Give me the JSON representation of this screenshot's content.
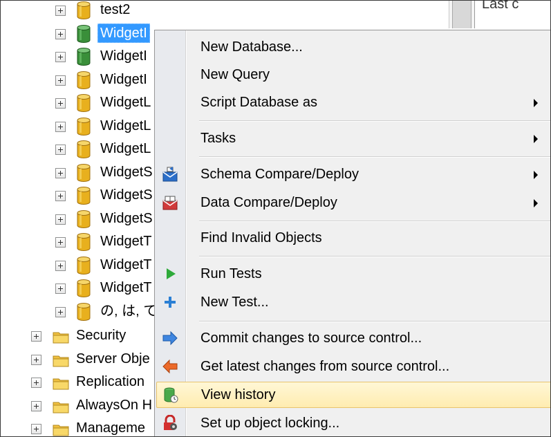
{
  "background": {
    "partial_text": "Last c"
  },
  "tree": {
    "databases": [
      {
        "label": "test2",
        "icon": "database-yellow-icon"
      },
      {
        "label": "WidgetI",
        "icon": "database-green-icon",
        "selected": true
      },
      {
        "label": "WidgetI",
        "icon": "database-green-icon"
      },
      {
        "label": "WidgetI",
        "icon": "database-yellow-icon"
      },
      {
        "label": "WidgetL",
        "icon": "database-yellow-icon"
      },
      {
        "label": "WidgetL",
        "icon": "database-yellow-icon"
      },
      {
        "label": "WidgetL",
        "icon": "database-yellow-icon"
      },
      {
        "label": "WidgetS",
        "icon": "database-yellow-icon"
      },
      {
        "label": "WidgetS",
        "icon": "database-yellow-icon"
      },
      {
        "label": "WidgetS",
        "icon": "database-yellow-icon"
      },
      {
        "label": "WidgetT",
        "icon": "database-yellow-icon"
      },
      {
        "label": "WidgetT",
        "icon": "database-yellow-icon"
      },
      {
        "label": "WidgetT",
        "icon": "database-yellow-icon"
      },
      {
        "label": "の, は, て",
        "icon": "database-yellow-icon"
      }
    ],
    "folders": [
      {
        "label": "Security",
        "icon": "folder-icon"
      },
      {
        "label": "Server Obje",
        "icon": "folder-icon"
      },
      {
        "label": "Replication",
        "icon": "folder-icon"
      },
      {
        "label": "AlwaysOn H",
        "icon": "folder-icon"
      },
      {
        "label": "Manageme",
        "icon": "folder-icon"
      }
    ]
  },
  "menu": {
    "items": {
      "new_database": "New Database...",
      "new_query": "New Query",
      "script_database_as": "Script Database as",
      "tasks": "Tasks",
      "schema_compare": "Schema Compare/Deploy",
      "data_compare": "Data Compare/Deploy",
      "find_invalid": "Find Invalid Objects",
      "run_tests": "Run Tests",
      "new_test": "New Test...",
      "commit_changes": "Commit changes to source control...",
      "get_latest": "Get latest changes from source control...",
      "view_history": "View history",
      "object_locking": "Set up object locking..."
    },
    "hovered": "view_history"
  },
  "colors": {
    "selection": "#3399ff",
    "hover_bg": "#ffecb0",
    "menu_bg": "#f0f0f0",
    "db_yellow": "#e8b01e",
    "db_green": "#3a8f3a"
  }
}
